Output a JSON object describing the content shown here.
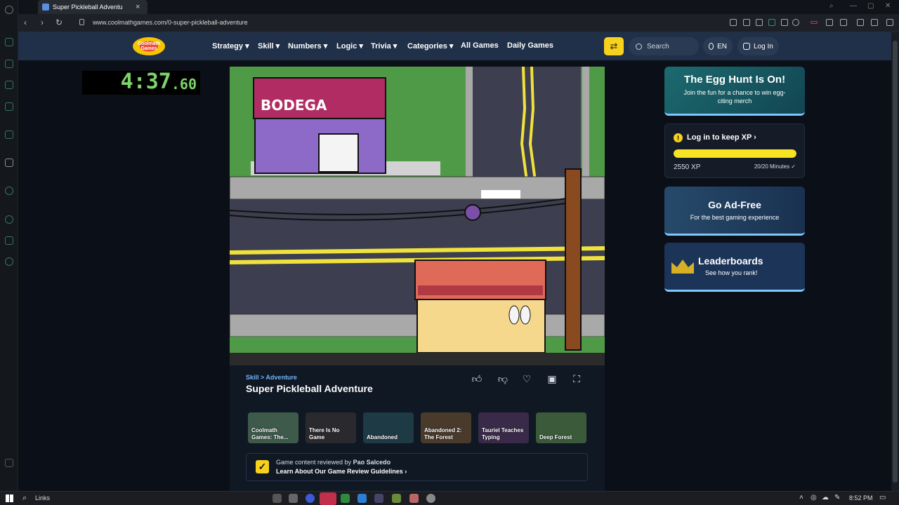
{
  "browser": {
    "tab_title": "Super Pickleball Adventu",
    "url": "www.coolmathgames.com/0-super-pickleball-adventure"
  },
  "site": {
    "logo_text": "Coolmath Games",
    "menu": [
      "Strategy",
      "Skill",
      "Numbers",
      "Logic",
      "Trivia",
      "Categories"
    ],
    "menu_links": [
      "All Games",
      "Daily Games"
    ],
    "search_placeholder": "Search",
    "language": "EN",
    "login": "Log In"
  },
  "timer": {
    "main": "4:37",
    "frac": ".60"
  },
  "game": {
    "sign": "BODEGA",
    "breadcrumb": "Skill > Adventure",
    "title": "Super Pickleball Adventure",
    "thumbs": [
      {
        "label": "Coolmath Games: The...",
        "color": "#3d5a4a"
      },
      {
        "label": "There Is No Game",
        "color": "#2a2a2e"
      },
      {
        "label": "Abandoned",
        "color": "#1e3a44"
      },
      {
        "label": "Abandoned 2: The Forest",
        "color": "#4a3a2c"
      },
      {
        "label": "Tauriel Teaches Typing",
        "color": "#3a2a4a"
      },
      {
        "label": "Deep Forest",
        "color": "#3a5a3a"
      }
    ],
    "review_line1_prefix": "Game content reviewed by ",
    "reviewer": "Pao Salcedo",
    "review_line2": "Learn About Our Game Review Guidelines ›"
  },
  "cards": {
    "egg_title": "The Egg Hunt Is On!",
    "egg_sub": "Join the fun for a chance to win egg-citing merch",
    "xp_title": "Log in to keep XP ›",
    "xp_amount": "2550 XP",
    "xp_minutes": "20/20 Minutes ✓",
    "xp_progress": 1.0,
    "adfree_title": "Go Ad-Free",
    "adfree_sub": "For the best gaming experience",
    "lead_title": "Leaderboards",
    "lead_sub": "See how you rank!"
  },
  "taskbar": {
    "links": "Links",
    "time": "8:52 PM"
  }
}
